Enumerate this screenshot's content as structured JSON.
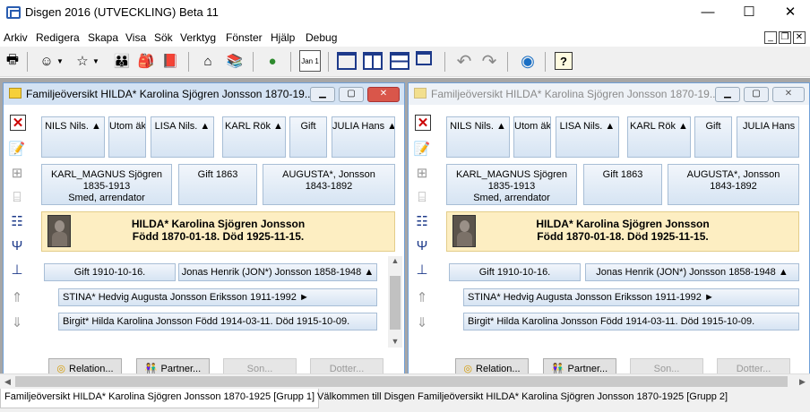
{
  "app": {
    "title": "Disgen 2016 (UTVECKLING) Beta 11",
    "min_label": "—",
    "max_label": "☐",
    "close_label": "✕"
  },
  "menu": [
    "Arkiv",
    "Redigera",
    "Skapa",
    "Visa",
    "Sök",
    "Verktyg",
    "Fönster",
    "Hjälp",
    "Debug"
  ],
  "mdi_controls": [
    "_",
    "❐",
    "✕"
  ],
  "toolbar": {
    "icons": [
      "printer-icon",
      "person-add-icon",
      "person-search-icon",
      "family-icon",
      "notes-icon",
      "book-icon",
      "home-icon",
      "books-icon",
      "map-icon",
      "calendar-icon",
      "layout-single-icon",
      "layout-two-col-icon",
      "layout-two-row-icon",
      "layout-cascade-icon",
      "undo-icon",
      "redo-icon",
      "globe-icon",
      "help-icon"
    ],
    "calendar_text": "Jan 1"
  },
  "windows": [
    {
      "title": "Familjeöversikt HILDA* Karolina Sjögren Jonsson 1870-19...",
      "active": true,
      "grandparents": [
        "NILS Nils.",
        "Utom äk",
        "LISA Nils.",
        "KARL Rök",
        "Gift",
        "JULIA Hans"
      ],
      "father": {
        "name": "KARL_MAGNUS Sjögren",
        "years": "1835-1913",
        "occupation": "Smed, arrendator"
      },
      "parents_marriage": "Gift 1863",
      "mother": {
        "name": "AUGUSTA*, Jonsson",
        "years": "1843-1892"
      },
      "main_person": {
        "name": "HILDA* Karolina Sjögren Jonsson",
        "dates": "Född 1870-01-18. Död 1925-11-15."
      },
      "marriage": "Gift 1910-10-16.",
      "spouse": "Jonas Henrik (JON*) Jonsson 1858-1948",
      "children": [
        "STINA* Hedvig Augusta Jonsson Eriksson 1911-1992",
        "Birgit* Hilda Karolina Jonsson Född 1914-03-11. Död 1915-10-09."
      ],
      "buttons": {
        "relation": "Relation...",
        "partner": "Partner...",
        "son": "Son...",
        "daughter": "Dotter..."
      }
    },
    {
      "title": "Familjeöversikt HILDA* Karolina Sjögren Jonsson 1870-19...",
      "active": false,
      "grandparents": [
        "NILS Nils.",
        "Utom äk",
        "LISA Nils.",
        "KARL Rök",
        "Gift",
        "JULIA Hans"
      ],
      "father": {
        "name": "KARL_MAGNUS Sjögren",
        "years": "1835-1913",
        "occupation": "Smed, arrendator"
      },
      "parents_marriage": "Gift 1863",
      "mother": {
        "name": "AUGUSTA*, Jonsson",
        "years": "1843-1892"
      },
      "main_person": {
        "name": "HILDA* Karolina Sjögren Jonsson",
        "dates": "Född 1870-01-18. Död 1925-11-15."
      },
      "marriage": "Gift 1910-10-16.",
      "spouse": "Jonas Henrik (JON*) Jonsson 1858-1948",
      "children": [
        "STINA* Hedvig Augusta Jonsson Eriksson 1911-1992",
        "Birgit* Hilda Karolina Jonsson Född 1914-03-11. Död 1915-10-09."
      ],
      "buttons": {
        "relation": "Relation...",
        "partner": "Partner...",
        "son": "Son...",
        "daughter": "Dotter..."
      }
    }
  ],
  "side_icons": [
    "close-x-icon",
    "edit-notes-icon",
    "tree-icon",
    "ancestors-icon",
    "descendants-list-icon",
    "pedigree-icon",
    "org-chart-icon",
    "up-arrow-icon",
    "down-arrow-icon"
  ],
  "tabs": [
    {
      "label": "Familjeöversikt HILDA* Karolina Sjögren Jonsson 1870-1925 [Grupp 1]",
      "active": true
    },
    {
      "label": "Välkommen till Disgen",
      "active": false
    },
    {
      "label": "Familjeöversikt HILDA* Karolina Sjögren Jonsson 1870-1925 [Grupp 2]",
      "active": false
    }
  ]
}
